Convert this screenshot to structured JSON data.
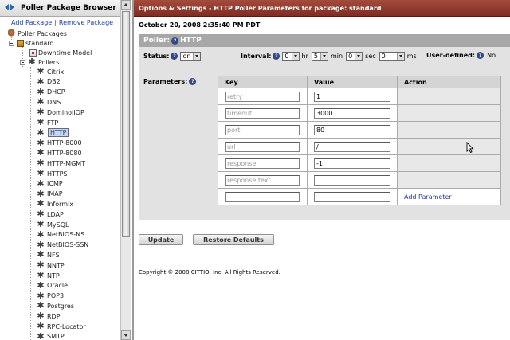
{
  "left_pane": {
    "title": "Poller Package Browser",
    "add_link": "Add Package",
    "separator": "|",
    "remove_link": "Remove Package",
    "tree": {
      "root": "Poller Packages",
      "package": "standard",
      "downtime": "Downtime Model",
      "pollers_folder": "Pollers",
      "selected": "HTTP",
      "pollers": [
        "Citrix",
        "DB2",
        "DHCP",
        "DNS",
        "DominoIIOP",
        "FTP",
        "HTTP",
        "HTTP-8000",
        "HTTP-8080",
        "HTTP-MGMT",
        "HTTPS",
        "ICMP",
        "IMAP",
        "Informix",
        "LDAP",
        "MySQL",
        "NetBIOS-NS",
        "NetBIOS-SSN",
        "NFS",
        "NNTP",
        "NTP",
        "Oracle",
        "POP3",
        "Postgres",
        "RDP",
        "RPC-Locator",
        "SMTP"
      ]
    }
  },
  "right_pane": {
    "title": "Options & Settings - HTTP Poller Parameters for package: standard",
    "datestamp": "October 20, 2008 2:35:40 PM PDT",
    "panel": {
      "head_label": "Poller:",
      "head_value": "HTTP",
      "status_label": "Status:",
      "status_value": "on",
      "interval_label": "Interval:",
      "hr_value": "0",
      "hr_unit": "hr",
      "min_value": "5",
      "min_unit": "min",
      "sec_value": "0",
      "sec_unit": "sec",
      "ms_value": "0",
      "ms_unit": "ms",
      "userdef_label": "User-defined:",
      "userdef_value": "No",
      "params_label": "Parameters:",
      "columns": {
        "key": "Key",
        "value": "Value",
        "action": "Action"
      },
      "rows": [
        {
          "key": "retry",
          "value": "1"
        },
        {
          "key": "timeout",
          "value": "3000"
        },
        {
          "key": "port",
          "value": "80"
        },
        {
          "key": "url",
          "value": "/"
        },
        {
          "key": "response",
          "value": "-1"
        },
        {
          "key": "response text",
          "value": ""
        },
        {
          "key": "",
          "value": "",
          "action": "Add Parameter"
        }
      ]
    },
    "buttons": {
      "update": "Update",
      "restore": "Restore Defaults"
    },
    "copyright": "Copyright © 2008 CITTIO, Inc. All Rights Reserved."
  },
  "icons": {
    "help": "?",
    "gear": "✱"
  }
}
